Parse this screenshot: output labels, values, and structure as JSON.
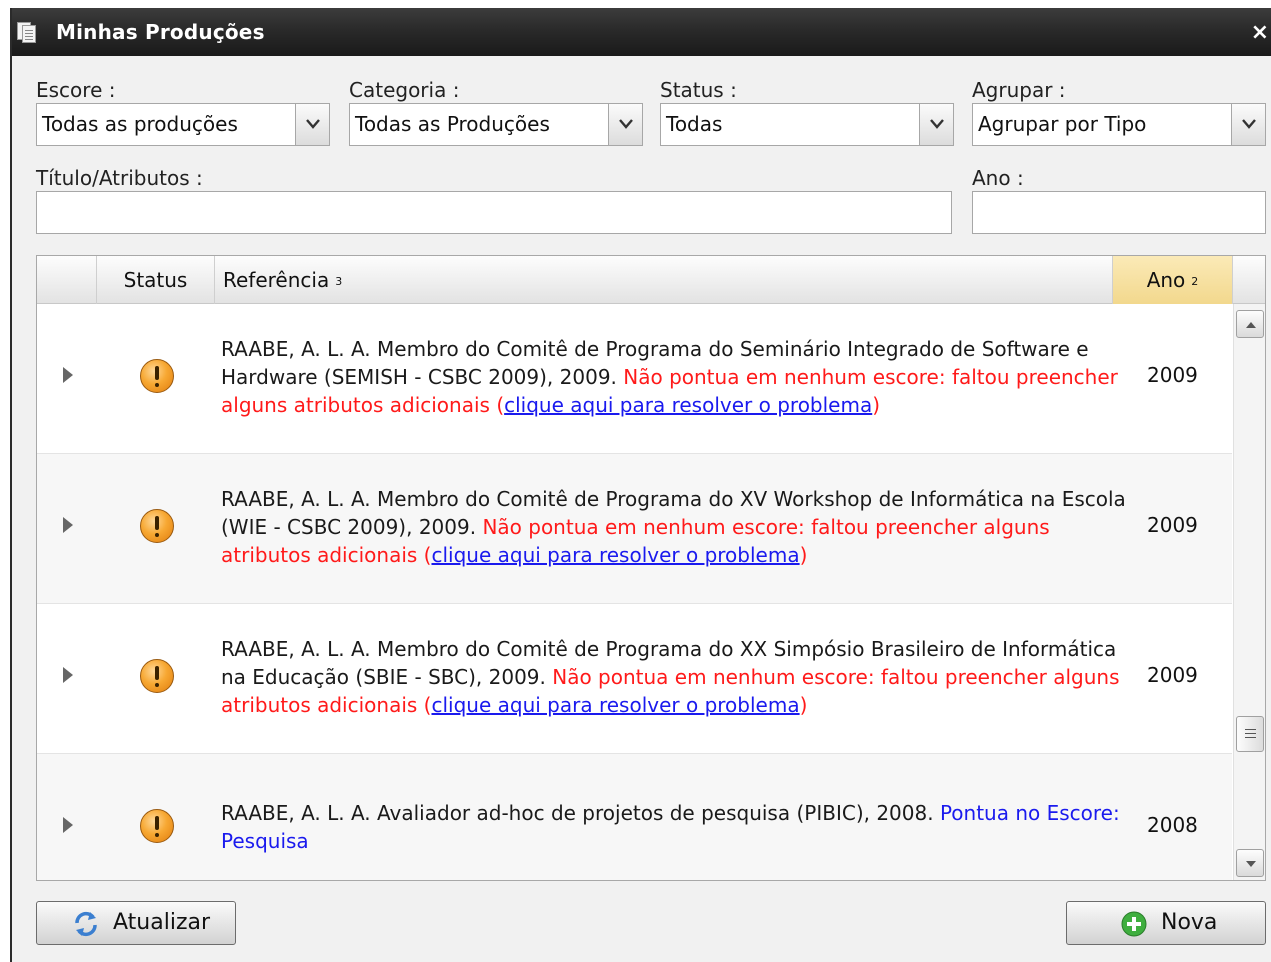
{
  "window": {
    "title": "Minhas Produções",
    "close_glyph": "×"
  },
  "filters": {
    "escore": {
      "label": "Escore :",
      "value": "Todas as produções"
    },
    "categoria": {
      "label": "Categoria :",
      "value": "Todas as Produções"
    },
    "status": {
      "label": "Status :",
      "value": "Todas"
    },
    "agrupar": {
      "label": "Agrupar :",
      "value": "Agrupar por Tipo"
    },
    "titulo": {
      "label": "Título/Atributos :",
      "value": ""
    },
    "ano": {
      "label": "Ano :",
      "value": ""
    }
  },
  "grid": {
    "columns": {
      "status": "Status",
      "referencia": "Referência",
      "referencia_sort": "3",
      "ano": "Ano",
      "ano_sort": "2"
    },
    "rows": [
      {
        "text": "RAABE, A. L. A. Membro do Comitê de Programa do Seminário Integrado de Software e Hardware (SEMISH - CSBC 2009), 2009.",
        "note": "Não pontua em nenhum escore: faltou preencher alguns atributos adicionais",
        "paren_open": "(",
        "link": "clique aqui para resolver o problema",
        "paren_close": ")",
        "year": "2009"
      },
      {
        "text": "RAABE, A. L. A. Membro do Comitê de Programa do XV Workshop de Informática na Escola (WIE - CSBC 2009), 2009.",
        "note": "Não pontua em nenhum escore: faltou preencher alguns atributos adicionais",
        "paren_open": "(",
        "link": "clique aqui para resolver o problema",
        "paren_close": ")",
        "year": "2009"
      },
      {
        "text": "RAABE, A. L. A. Membro do Comitê de Programa do XX Simpósio Brasileiro de Informática na Educação (SBIE - SBC), 2009.",
        "note": "Não pontua em nenhum escore: faltou preencher alguns atributos adicionais",
        "paren_open": "(",
        "link": "clique aqui para resolver o problema",
        "paren_close": ")",
        "year": "2009"
      },
      {
        "text": "RAABE, A. L. A. Avaliador ad-hoc de projetos de pesquisa (PIBIC), 2008.",
        "score": "Pontua no Escore: Pesquisa",
        "year": "2008"
      }
    ]
  },
  "buttons": {
    "atualizar": "Atualizar",
    "nova": "Nova"
  },
  "icons": {
    "title": "documents-icon",
    "refresh": "refresh-icon",
    "add": "add-circle-icon",
    "warning": "warning-icon",
    "expander": "expand-arrow-icon"
  },
  "colors": {
    "warning_text": "#ff1a1a",
    "link": "#1a1aee",
    "sorted_header": "#f7e2a0",
    "add_icon": "#3fae3f"
  }
}
